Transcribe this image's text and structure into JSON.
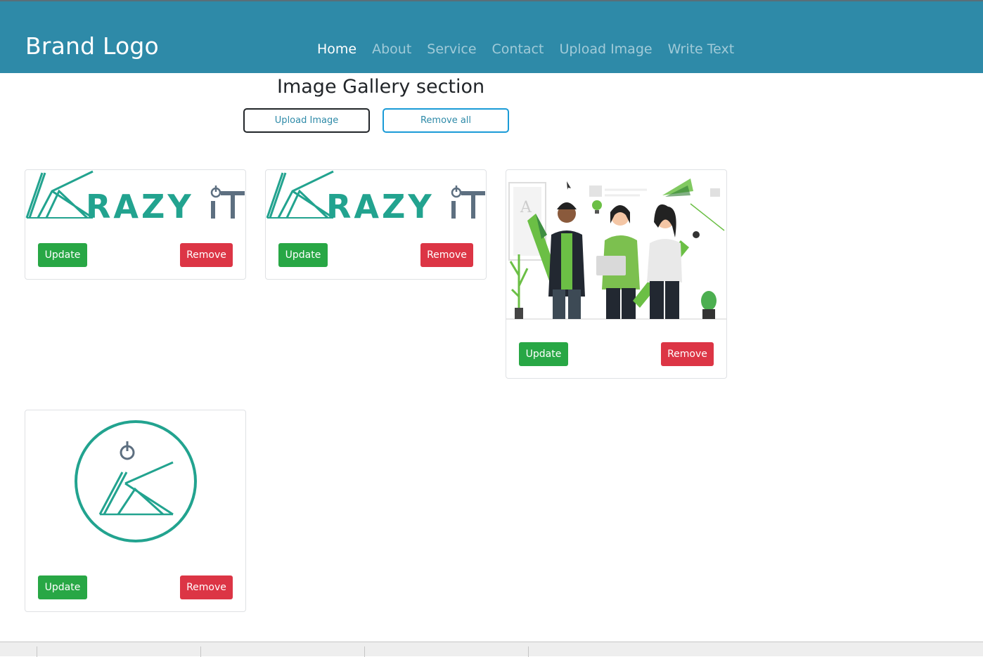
{
  "navbar": {
    "brand": "Brand Logo",
    "links": [
      "Home",
      "About",
      "Service",
      "Contact",
      "Upload Image",
      "Write Text"
    ],
    "active": "Home",
    "background": "#2e8aa8"
  },
  "gallery": {
    "title": "Image Gallery section",
    "upload_label": "Upload Image",
    "remove_all_label": "Remove all"
  },
  "cards": [
    {
      "image": "krazyit-wordmark-logo",
      "logo_text": "RAZY",
      "logo_suffix": "iT",
      "update_label": "Update",
      "remove_label": "Remove"
    },
    {
      "image": "krazyit-wordmark-logo",
      "logo_text": "RAZY",
      "logo_suffix": "iT",
      "update_label": "Update",
      "remove_label": "Remove"
    },
    {
      "image": "team-illustration",
      "update_label": "Update",
      "remove_label": "Remove"
    },
    {
      "image": "krazyit-circle-logo",
      "update_label": "Update",
      "remove_label": "Remove"
    }
  ],
  "colors": {
    "logo_teal": "#22a38f",
    "logo_slate": "#5d6f80",
    "update": "#28a745",
    "remove": "#dc3545"
  }
}
